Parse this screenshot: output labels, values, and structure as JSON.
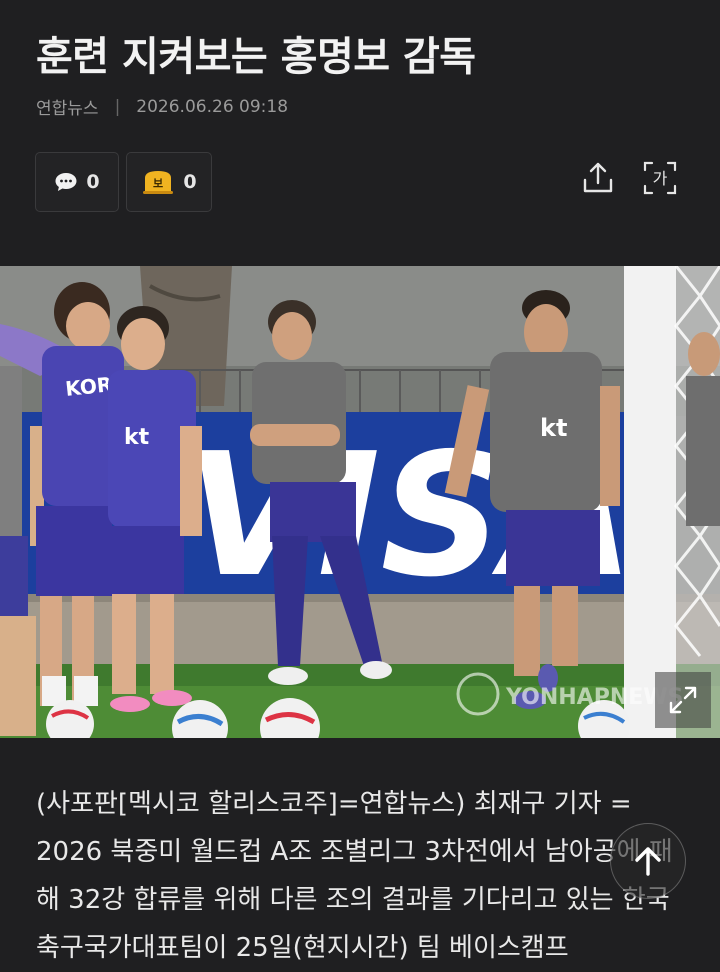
{
  "article": {
    "headline": "훈련 지켜보는 홍명보 감독",
    "source": "연합뉴스",
    "separator": "|",
    "datetime": "2026.06.26 09:18"
  },
  "actions": {
    "comment_count": "0",
    "reaction_count": "0",
    "reaction_badge": "보",
    "font_icon_label": "가"
  },
  "photo": {
    "banner_text": "VISA",
    "jersey_text": "KOREA",
    "sponsor_logo": "kt",
    "watermark": "YONHAPNEWS"
  },
  "body": {
    "text": "(사포판[멕시코 할리스코주]=연합뉴스) 최재구 기자 = 2026 북중미 월드컵 A조 조별리그 3차전에서 남아공에 패해 32강 합류를 위해 다른 조의 결과를 기다리고 있는 한국 축구국가대표팀이 25일(현지시간) 팀 베이스캠프"
  },
  "colors": {
    "background": "#1f1f21",
    "reaction_yellow": "#f0b321"
  }
}
